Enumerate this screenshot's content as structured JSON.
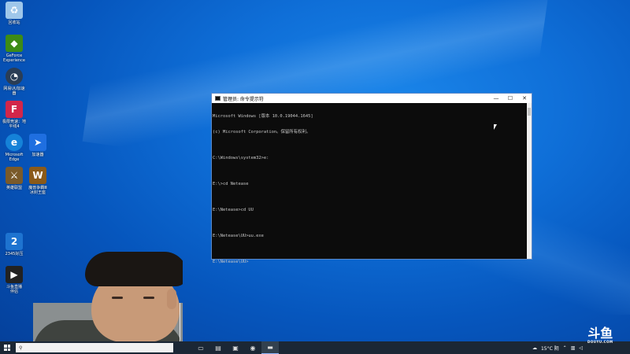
{
  "desktop": {
    "icons": [
      {
        "label": "回收站",
        "icon": "recycle-bin-icon",
        "color": "#9fc7ea"
      },
      {
        "label": "GeForce\nExperience",
        "icon": "nvidia-icon",
        "color": "#3d8b16"
      },
      {
        "label": "网易UU加速\n器",
        "icon": "uu-booster-icon",
        "color": "#2a3d55"
      },
      {
        "label": "极限竞速：地\n平线4",
        "icon": "forza-icon",
        "color": "#d2264a"
      },
      {
        "label": "Microsoft\nEdge",
        "icon": "edge-icon",
        "color": "#1582d8"
      },
      {
        "label": "加速器",
        "icon": "booster-icon",
        "color": "#1f6fe0"
      },
      {
        "label": "英雄联盟",
        "icon": "lol-icon",
        "color": "#7a5a2a"
      },
      {
        "label": "魔兽争霸Ⅲ\n冰封王座",
        "icon": "warcraft-icon",
        "color": "#8a5a1a"
      },
      {
        "label": "2345好压",
        "icon": "compressor-icon",
        "color": "#1e73d0"
      },
      {
        "label": "斗鱼直播\n伴侣",
        "icon": "obs-icon",
        "color": "#222222"
      }
    ]
  },
  "console": {
    "title": "管理员: 命令提示符",
    "minimize": "—",
    "maximize": "☐",
    "close": "✕",
    "lines": [
      "Microsoft Windows [版本 10.0.19044.1645]",
      "(c) Microsoft Corporation。保留所有权利。",
      "",
      "C:\\Windows\\system32>e:",
      "",
      "E:\\>cd Netease",
      "",
      "E:\\Netease>cd UU",
      "",
      "E:\\Netease\\UU>uu.exe",
      "",
      "E:\\Netease\\UU>"
    ]
  },
  "taskbar": {
    "search_placeholder": "",
    "apps": [
      {
        "icon": "task-view-icon",
        "glyph": "▭"
      },
      {
        "icon": "file-explorer-icon",
        "glyph": "▤"
      },
      {
        "icon": "store-icon",
        "glyph": "▣"
      },
      {
        "icon": "network-app-icon",
        "glyph": "◉"
      },
      {
        "icon": "cmd-icon",
        "glyph": "▬"
      }
    ],
    "weather": "15°C 阴",
    "watermark_big": "斗鱼",
    "watermark_small": "DOUYU.COM"
  },
  "colors": {
    "desktop_bg": "#0f6fd8",
    "taskbar_bg": "#1b2735",
    "console_bg": "#0c0c0c"
  }
}
